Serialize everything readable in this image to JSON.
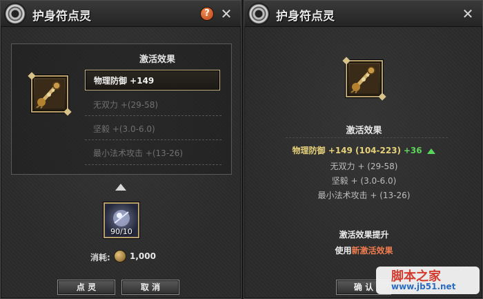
{
  "left_panel": {
    "title": "护身符点灵",
    "header": "激活效果",
    "options": [
      {
        "label": "物理防御 +149"
      },
      {
        "label": "无双力 +(29-58)"
      },
      {
        "label": "坚毅 +(3.0-6.0)"
      },
      {
        "label": "最小法术攻击 +(13-26)"
      }
    ],
    "gem_count": "90/10",
    "cost_label": "消耗:",
    "cost_value": "1,000",
    "buttons": {
      "confirm": "点 灵",
      "cancel": "取 消"
    }
  },
  "right_panel": {
    "title": "护身符点灵",
    "header": "激活效果",
    "main_stat": "物理防御 +149 (104-223)",
    "main_delta": "+36",
    "stats": [
      "无双力 + (29-58)",
      "坚毅 + (3.0-6.0)",
      "最小法术攻击 + (13-26)"
    ],
    "promo_title": "激活效果提升",
    "promo_prefix": "使用",
    "promo_accent": "新激活效果",
    "button_ok": "确 认"
  },
  "watermark": {
    "big": "脚本之家",
    "small": "www.jb51.net"
  },
  "colors": {
    "gold": "#e6d17a",
    "green": "#5fd35b",
    "accent": "#f07d4f"
  },
  "icons": {
    "help": "?",
    "close": "✕"
  }
}
